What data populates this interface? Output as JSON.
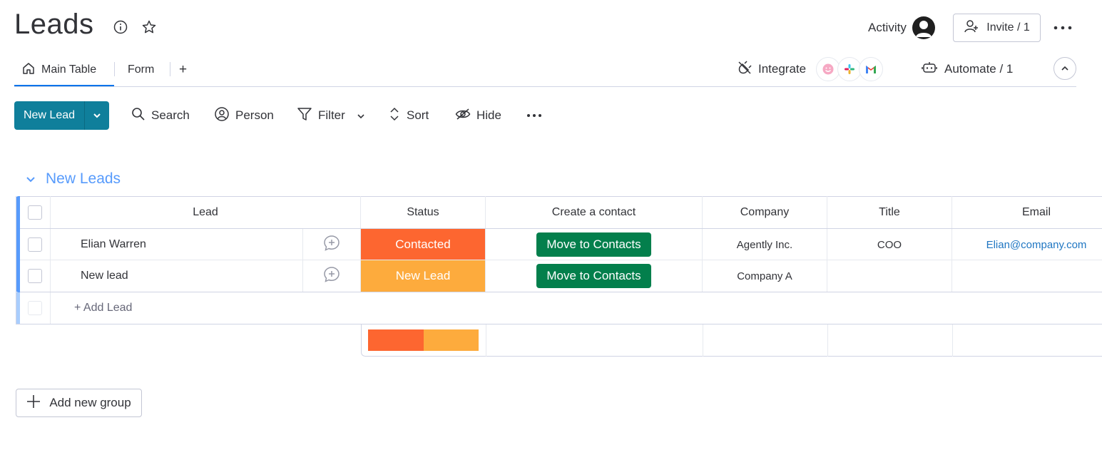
{
  "header": {
    "title": "Leads",
    "activity_label": "Activity",
    "invite_label": "Invite / 1"
  },
  "views": {
    "tabs": [
      {
        "label": "Main Table",
        "active": true
      },
      {
        "label": "Form",
        "active": false
      }
    ],
    "add_view": "+",
    "integrate_label": "Integrate",
    "automate_label": "Automate / 1"
  },
  "toolbar": {
    "new_item_label": "New Lead",
    "search_label": "Search",
    "person_label": "Person",
    "filter_label": "Filter",
    "sort_label": "Sort",
    "hide_label": "Hide"
  },
  "group": {
    "title": "New Leads",
    "color": "#579bfc",
    "columns": [
      "Lead",
      "Status",
      "Create a contact",
      "Company",
      "Title",
      "Email"
    ],
    "rows": [
      {
        "lead": "Elian Warren",
        "status": "Contacted",
        "status_color": "#fd6630",
        "contact_button": "Move to Contacts",
        "company": "Agently Inc.",
        "title": "COO",
        "email": "Elian@company.com"
      },
      {
        "lead": "New lead",
        "status": "New Lead",
        "status_color": "#fdab3d",
        "contact_button": "Move to Contacts",
        "company": "Company A",
        "title": "",
        "email": ""
      }
    ],
    "add_item_label": "+ Add Lead",
    "status_summary": [
      {
        "label": "Contacted",
        "fraction": 0.5,
        "color": "#fd6630"
      },
      {
        "label": "New Lead",
        "fraction": 0.5,
        "color": "#fdab3d"
      }
    ]
  },
  "add_group_label": "Add new group",
  "icons": {
    "info": "info-icon",
    "favorite": "star-icon",
    "home": "home-icon",
    "integrate": "plug-icon",
    "automate": "robot-icon",
    "search": "search-icon",
    "person": "person-icon",
    "filter": "filter-icon",
    "sort": "sort-icon",
    "hide": "eye-off-icon",
    "more": "more-icon",
    "update": "chat-plus-icon"
  }
}
